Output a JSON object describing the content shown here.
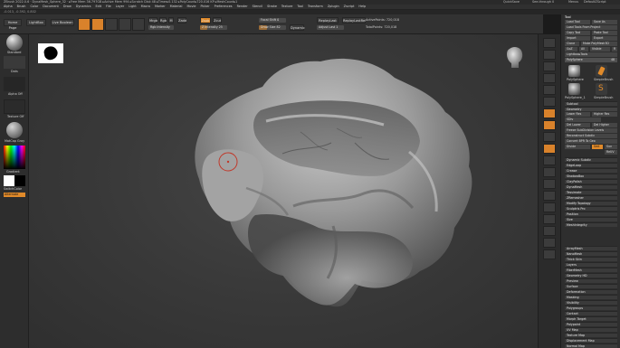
{
  "titlebar": {
    "title": "ZBrush 2022.0.6 · DynaMesh_Sphere_32 · ▸Free Mem 36.797GB ▸Active Mem 994 ▸Scratch Disk 48 ▸Timer▸0.132 ▸PolyCount▸720.016 KP ▸MeshCount▸1",
    "quicksave": "QuickSave",
    "see_through": "See-through 0",
    "menus_label": "Menus",
    "script_label": "DefaultZScript"
  },
  "menus": [
    "Alpha",
    "Brush",
    "Color",
    "Document",
    "Draw",
    "Dynamics",
    "Edit",
    "File",
    "Layer",
    "Light",
    "Macro",
    "Marker",
    "Material",
    "Movie",
    "Picker",
    "Preferences",
    "Render",
    "Stencil",
    "Stroke",
    "Texture",
    "Tool",
    "Transform",
    "Zplugin",
    "Zscript",
    "Help"
  ],
  "subbar_text": "-0.013, -0.392, 0.802",
  "shelf": {
    "home_page": "Home Page",
    "lightbox": "LightBox",
    "live_boolean": "Live Boolean",
    "edit": "Edit",
    "draw": "Draw",
    "move": "Move",
    "scale": "Scale",
    "rotate": "Rotate",
    "mrgb": "Mrgb",
    "rgb": "Rgb",
    "m": "M",
    "zadd": "Zadd",
    "zsub": "Zsub",
    "zcut": "Zcut",
    "rgb_intensity": "Rgb Intensity",
    "z_intensity": "Z Intensity 25",
    "focal_shift": "Focal Shift 0",
    "draw_size": "Draw Size 82",
    "dynamic": "Dynamic",
    "replay_last": "ReplayLast",
    "replay_last_rel": "ReplayLastRel",
    "adjust_last": "Adjust Last 1",
    "active_points": "ActivePoints: 720,018",
    "total_points": "TotalPoints: 720,018",
    "z_intensity_level": 0.25,
    "draw_size_level": 0.3
  },
  "left_panel": {
    "standard": "Standard",
    "dots": "Dots",
    "alpha_off": "Alpha Off",
    "texture_off": "Texture Off",
    "material": "MatCap Gray",
    "gradient": "Gradient",
    "switch_color": "SwitchColor",
    "alternate": "Alternate"
  },
  "palette": {
    "title": "Tool",
    "load_tool": "Load Tool",
    "save_as": "Save As",
    "load_tools_from_project": "Load Tools From Project",
    "copy_tool": "Copy Tool",
    "paste_tool": "Paste Tool",
    "import": "Import",
    "export": "Export",
    "clone": "Clone",
    "make_polymesh3d": "Make PolyMesh3D",
    "goz": "GoZ",
    "all": "All",
    "visible": "Visible",
    "r": "R",
    "lightbox_tools": "Lightbox▸Tools",
    "polysphere_label": "PolySphere",
    "polysphere_count": "48",
    "thumbs": [
      "PolySphere",
      "SimpleBrush",
      "PolySphere_1",
      "SimpleBrush"
    ],
    "subtool": "Subtool",
    "geometry": "Geometry",
    "lower_res": "Lower Res",
    "higher_res": "Higher Res",
    "sdiv": "SDiv",
    "del_lower": "Del Lower",
    "del_higher": "Del Higher",
    "freeze_subdivision": "Freeze SubDivision Levels",
    "reconstruct_subdiv": "Reconstruct Subdiv",
    "convert_bpr": "Convert BPR To Geo",
    "divide": "Divide",
    "smt": "Smt",
    "suv": "Suv",
    "rel": "ReUV",
    "dynamic_subdiv": "Dynamic Subdiv",
    "edgeloop": "EdgeLoop",
    "crease": "Crease",
    "shadowbox": "ShadowBox",
    "claypolish": "ClayPolish",
    "dynamesh": "DynaMesh",
    "tessimate": "Tessimate",
    "zremesher": "ZRemesher",
    "modify_topology": "Modify Topology",
    "sculptris_pro": "Sculptris Pro",
    "position": "Position",
    "size": "Size",
    "meshintegrity": "MeshIntegrity",
    "sections": [
      "ArrayMesh",
      "NanoMesh",
      "Thick Skin",
      "Layers",
      "FiberMesh",
      "Geometry HD",
      "Preview",
      "Surface",
      "Deformation",
      "Masking",
      "Visibility",
      "Polygroups",
      "Contact",
      "Morph Target",
      "Polypaint",
      "UV Map",
      "Texture Map",
      "Displacement Map",
      "Normal Map"
    ]
  },
  "colors": {
    "accent": "#e08a2a",
    "panel": "#2e2e2e",
    "canvas": "#3b3b3b",
    "sculpt_base": "#8d8d8d",
    "cursor_ring": "#c0392b"
  }
}
